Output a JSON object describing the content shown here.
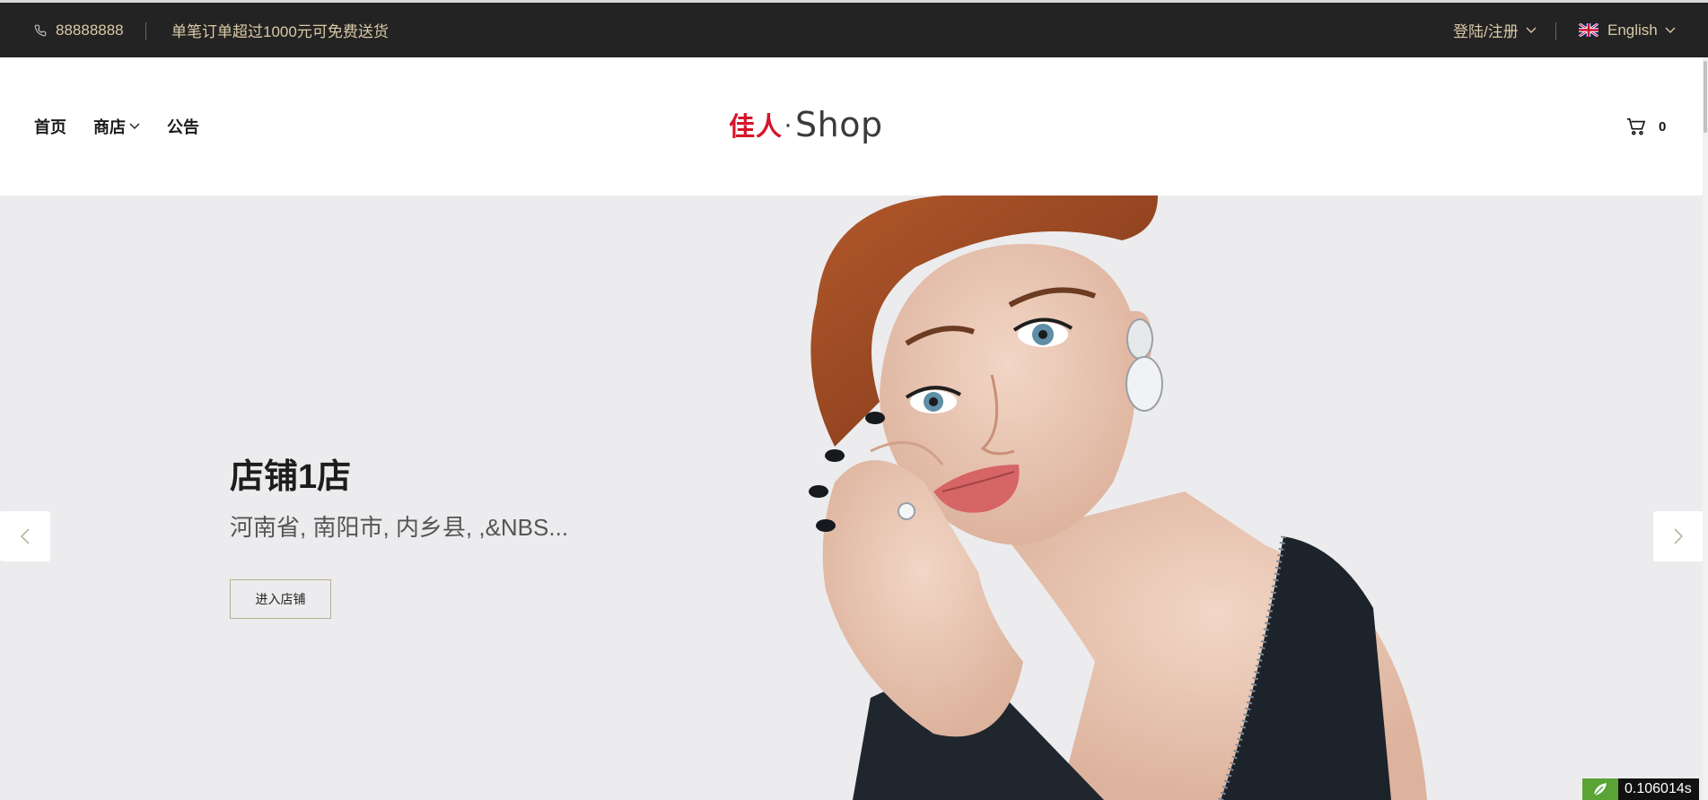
{
  "topbar": {
    "phone": "88888888",
    "promo": "单笔订单超过1000元可免费送货",
    "login_register": "登陆/注册",
    "language": "English"
  },
  "nav": {
    "home": "首页",
    "shop": "商店",
    "notice": "公告"
  },
  "logo": {
    "cn": "佳人",
    "dot": "·",
    "en": "Shop"
  },
  "cart": {
    "count": "0"
  },
  "slider": {
    "title": "店铺1店",
    "subtitle": "河南省, 南阳市, 内乡县, ,&NBS...",
    "button": "进入店铺"
  },
  "debug": {
    "timing": "0.106014s"
  },
  "colors": {
    "topbar_bg": "#232323",
    "topbar_text": "#d9c9a6",
    "logo_red": "#d7142a",
    "hero_bg": "#ececee",
    "button_border": "#b8ae92"
  },
  "icons": [
    "phone-icon",
    "chevron-down-icon",
    "uk-flag-icon",
    "cart-icon",
    "arrow-left-icon",
    "arrow-right-icon",
    "leaf-icon"
  ]
}
